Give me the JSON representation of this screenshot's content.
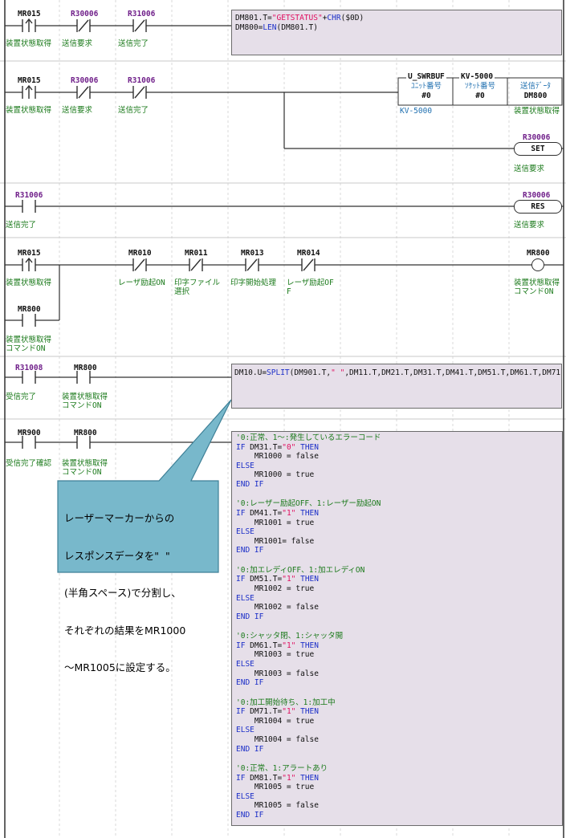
{
  "rungs": {
    "r1": {
      "contacts": [
        {
          "device": "MR015",
          "comment": "装置状態取得"
        },
        {
          "device": "R30006",
          "comment": "送信要求"
        },
        {
          "device": "R31006",
          "comment": "送信完了"
        }
      ],
      "code": [
        "DM801.T=\"GETSTATUS\"+CHR($0D)",
        "DM800=LEN(DM801.T)"
      ]
    },
    "r2": {
      "contacts": [
        {
          "device": "MR015",
          "comment": "装置状態取得"
        },
        {
          "device": "R30006",
          "comment": "送信要求"
        },
        {
          "device": "R31006",
          "comment": "送信完了"
        }
      ],
      "fb_name": "U_SWRBUF",
      "fb_target": "KV-5000",
      "fb_params": [
        {
          "label": "ﾕﾆｯﾄ番号",
          "value": "#0"
        },
        {
          "label": "ｿｹｯﾄ番号",
          "value": "#0"
        },
        {
          "label": "送信ﾃﾞｰﾀ",
          "value": "DM800"
        }
      ],
      "fb_below_left": "KV-5000",
      "fb_below_right": "装置状態取得",
      "set_coil": {
        "device": "R30006",
        "op": "SET",
        "comment": "送信要求"
      }
    },
    "r3": {
      "contact": {
        "device": "R31006",
        "comment": "送信完了"
      },
      "res_coil": {
        "device": "R30006",
        "op": "RES",
        "comment": "送信要求"
      }
    },
    "r4": {
      "contacts": [
        {
          "device": "MR015",
          "comment": "装置状態取得"
        },
        {
          "device": "MR010",
          "comment": "レーザ励起ON"
        },
        {
          "device": "MR011",
          "comment": "印字ファイル",
          "comment2": "選択"
        },
        {
          "device": "MR013",
          "comment": "印字開始処理"
        },
        {
          "device": "MR014",
          "comment": "レーザ励起OF",
          "comment2": "F"
        }
      ],
      "parallel": {
        "device": "MR800",
        "comment": "装置状態取得",
        "comment2": "コマンドON"
      },
      "coil": {
        "device": "MR800",
        "comment": "装置状態取得",
        "comment2": "コマンドON"
      }
    },
    "r5": {
      "contacts": [
        {
          "device": "R31008",
          "comment": "受信完了"
        },
        {
          "device": "MR800",
          "comment": "装置状態取得",
          "comment2": "コマンドON"
        }
      ],
      "code": "DM10.U=SPLIT(DM901.T,\" \",DM11.T,DM21.T,DM31.T,DM41.T,DM51.T,DM61.T,DM71"
    },
    "r6": {
      "contacts": [
        {
          "device": "MR900",
          "comment": "受信完了確認"
        },
        {
          "device": "MR800",
          "comment": "装置状態取得",
          "comment2": "コマンドON"
        }
      ]
    }
  },
  "script_blocks": [
    {
      "comment": "'0:正常、1～:発生しているエラーコード",
      "cond_dev": "DM31.T=",
      "cond_val": "\"0\"",
      "then_line": "MR1000 = false",
      "else_line": "MR1000 = true"
    },
    {
      "comment": "'0:レーザー励起OFF、1:レーザー励起ON",
      "cond_dev": "DM41.T=",
      "cond_val": "\"1\"",
      "then_line": "MR1001 = true",
      "else_line": "MR1001= false"
    },
    {
      "comment": "'0:加エレディOFF、1:加エレディON",
      "cond_dev": "DM51.T=",
      "cond_val": "\"1\"",
      "then_line": "MR1002 = true",
      "else_line": "MR1002 = false"
    },
    {
      "comment": "'0:シャッタ閉、1:シャッタ開",
      "cond_dev": "DM61.T=",
      "cond_val": "\"1\"",
      "then_line": "MR1003 = true",
      "else_line": "MR1003 = false"
    },
    {
      "comment": "'0:加工開始待ち、1:加工中",
      "cond_dev": "DM71.T=",
      "cond_val": "\"1\"",
      "then_line": "MR1004 = true",
      "else_line": "MR1004 = false"
    },
    {
      "comment": "'0:正常、1:アラートあり",
      "cond_dev": "DM81.T=",
      "cond_val": "\"1\"",
      "then_line": "MR1005 = true",
      "else_line": "MR1005 = false"
    }
  ],
  "keywords": {
    "if": "IF",
    "then": "THEN",
    "else": "ELSE",
    "endif": "END IF"
  },
  "callout": {
    "lines": [
      "レーザーマーカーからの",
      "レスポンスデータを\"  \"",
      "(半角スペース)で分割し、",
      "それぞれの結果をMR1000",
      "～MR1005に設定する。"
    ]
  },
  "colors": {
    "callout_fill": "#78b8cb",
    "callout_border": "#3d7f96",
    "box_fill": "#e6dfe9",
    "comment": "#1b7a1b",
    "device_purple": "#70208a",
    "keyword": "#1c2fc8",
    "string": "#e01060"
  }
}
